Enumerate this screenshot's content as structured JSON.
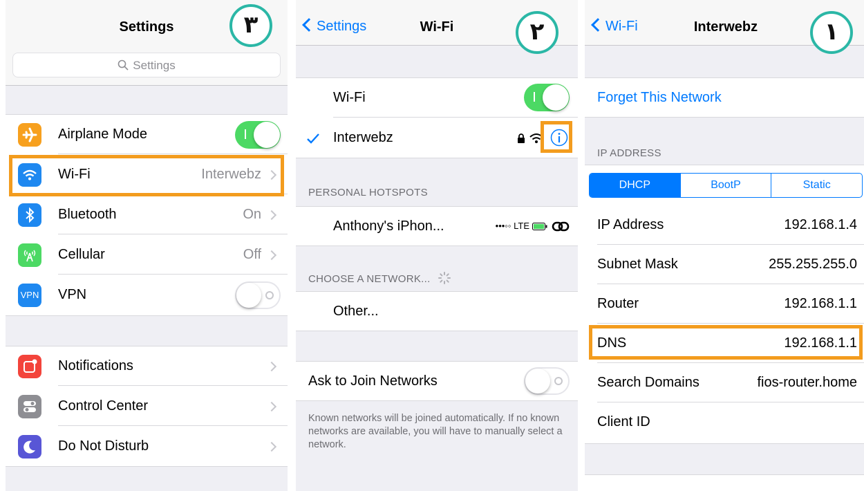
{
  "colors": {
    "accent": "#007aff",
    "toggle_on": "#4cd964",
    "highlight": "#f39c1e",
    "badge_ring": "#2bb7a6"
  },
  "panel1": {
    "title": "Settings",
    "badge": "٣",
    "search_placeholder": "Settings",
    "airplane_label": "Airplane Mode",
    "wifi_label": "Wi-Fi",
    "wifi_value": "Interwebz",
    "bluetooth_label": "Bluetooth",
    "bluetooth_value": "On",
    "cellular_label": "Cellular",
    "cellular_value": "Off",
    "vpn_label": "VPN",
    "vpn_icon_text": "VPN",
    "notifications_label": "Notifications",
    "control_center_label": "Control Center",
    "dnd_label": "Do Not Disturb"
  },
  "panel2": {
    "back_label": "Settings",
    "title": "Wi-Fi",
    "badge": "٢",
    "wifi_label": "Wi-Fi",
    "network_name": "Interwebz",
    "hotspots_header": "PERSONAL HOTSPOTS",
    "hotspot_name": "Anthony's iPhon...",
    "hotspot_signal": "•••◦◦ LTE",
    "choose_header": "CHOOSE A NETWORK...",
    "other_label": "Other...",
    "ask_join_label": "Ask to Join Networks",
    "footer_text": "Known networks will be joined automatically. If no known networks are available, you will have to manually select a network."
  },
  "panel3": {
    "back_label": "Wi-Fi",
    "title": "Interwebz",
    "badge": "١",
    "forget_label": "Forget This Network",
    "ip_header": "IP ADDRESS",
    "seg_dhcp": "DHCP",
    "seg_bootp": "BootP",
    "seg_static": "Static",
    "rows": [
      {
        "label": "IP Address",
        "value": "192.168.1.4"
      },
      {
        "label": "Subnet Mask",
        "value": "255.255.255.0"
      },
      {
        "label": "Router",
        "value": "192.168.1.1"
      },
      {
        "label": "DNS",
        "value": "192.168.1.1"
      },
      {
        "label": "Search Domains",
        "value": "fios-router.home"
      },
      {
        "label": "Client ID",
        "value": ""
      }
    ]
  }
}
